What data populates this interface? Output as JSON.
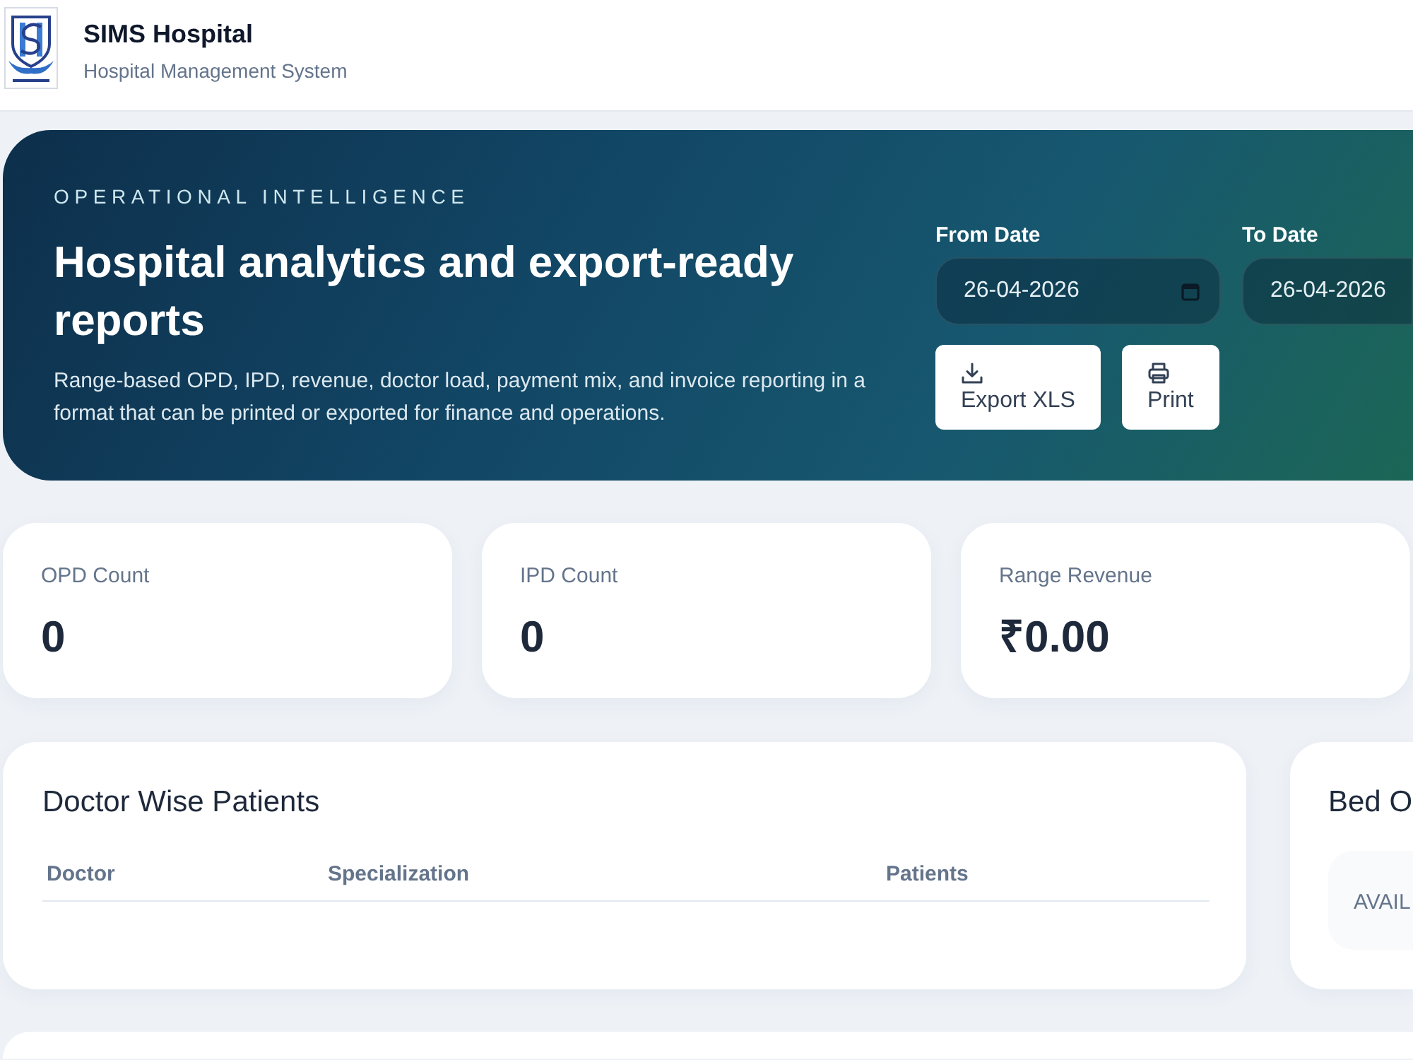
{
  "header": {
    "title": "SIMS Hospital",
    "subtitle": "Hospital Management System"
  },
  "hero": {
    "eyebrow": "OPERATIONAL INTELLIGENCE",
    "title": "Hospital analytics and export-ready reports",
    "description": "Range-based OPD, IPD, revenue, doctor load, payment mix, and invoice reporting in a format that can be printed or exported for finance and operations.",
    "date_fields": [
      {
        "label": "From Date",
        "value": "26-04-2026"
      },
      {
        "label": "To Date",
        "value": "26-04-2026"
      }
    ],
    "buttons": [
      {
        "label": "Export XLS",
        "kind": "download"
      },
      {
        "label": "Print",
        "kind": "print"
      }
    ]
  },
  "stats": [
    {
      "label": "OPD Count",
      "value": "0"
    },
    {
      "label": "IPD Count",
      "value": "0"
    },
    {
      "label": "Range Revenue",
      "value": "₹0.00"
    }
  ],
  "doctor_table": {
    "title": "Doctor Wise Patients",
    "columns": [
      "Doctor",
      "Specialization",
      "Patients"
    ]
  },
  "bed_panel": {
    "title": "Bed O",
    "items": [
      {
        "label": "AVAIL"
      }
    ]
  }
}
